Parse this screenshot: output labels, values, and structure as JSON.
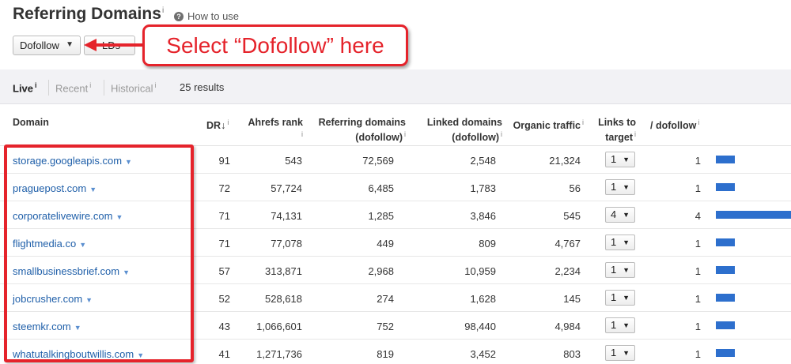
{
  "header": {
    "title": "Referring Domains",
    "title_info": "i",
    "howto_icon": "?",
    "howto_label": "How to use"
  },
  "filters": {
    "dofollow_label": "Dofollow",
    "caret": "▼",
    "second_partial": "LDs"
  },
  "annotation": {
    "callout_text": "Select “Dofollow” here",
    "accent_color": "#e5232b"
  },
  "tabs": [
    {
      "label": "Live",
      "info": "i"
    },
    {
      "label": "Recent",
      "info": "i"
    },
    {
      "label": "Historical",
      "info": "i"
    }
  ],
  "results_text": "25 results",
  "columns": {
    "domain": "Domain",
    "dr": "DR",
    "dr_sort": "↓",
    "ahrefs_rank": "Ahrefs rank",
    "ref_domains_1": "Referring domains",
    "ref_domains_2": "(dofollow)",
    "linked_domains_1": "Linked domains",
    "linked_domains_2": "(dofollow)",
    "organic_traffic": "Organic traffic",
    "links_to_1": "Links to",
    "links_to_2": "target",
    "dofollow": "/ dofollow",
    "info": "i"
  },
  "rows": [
    {
      "domain": "storage.googleapis.com",
      "dr": "91",
      "rank": "543",
      "ref": "72,569",
      "linked": "2,548",
      "traffic": "21,324",
      "links": "1",
      "dofollow": "1",
      "bar_fraction": 0.25
    },
    {
      "domain": "praguepost.com",
      "dr": "72",
      "rank": "57,724",
      "ref": "6,485",
      "linked": "1,783",
      "traffic": "56",
      "links": "1",
      "dofollow": "1",
      "bar_fraction": 0.25
    },
    {
      "domain": "corporatelivewire.com",
      "dr": "71",
      "rank": "74,131",
      "ref": "1,285",
      "linked": "3,846",
      "traffic": "545",
      "links": "4",
      "dofollow": "4",
      "bar_fraction": 1.0
    },
    {
      "domain": "flightmedia.co",
      "dr": "71",
      "rank": "77,078",
      "ref": "449",
      "linked": "809",
      "traffic": "4,767",
      "links": "1",
      "dofollow": "1",
      "bar_fraction": 0.25
    },
    {
      "domain": "smallbusinessbrief.com",
      "dr": "57",
      "rank": "313,871",
      "ref": "2,968",
      "linked": "10,959",
      "traffic": "2,234",
      "links": "1",
      "dofollow": "1",
      "bar_fraction": 0.25
    },
    {
      "domain": "jobcrusher.com",
      "dr": "52",
      "rank": "528,618",
      "ref": "274",
      "linked": "1,628",
      "traffic": "145",
      "links": "1",
      "dofollow": "1",
      "bar_fraction": 0.25
    },
    {
      "domain": "steemkr.com",
      "dr": "43",
      "rank": "1,066,601",
      "ref": "752",
      "linked": "98,440",
      "traffic": "4,984",
      "links": "1",
      "dofollow": "1",
      "bar_fraction": 0.25
    },
    {
      "domain": "whatutalkingboutwillis.com",
      "dr": "41",
      "rank": "1,271,736",
      "ref": "819",
      "linked": "3,452",
      "traffic": "803",
      "links": "1",
      "dofollow": "1",
      "bar_fraction": 0.25
    }
  ],
  "colors": {
    "link": "#1f5fa9",
    "bar": "#2d6fcd",
    "highlight": "#e5232b"
  }
}
